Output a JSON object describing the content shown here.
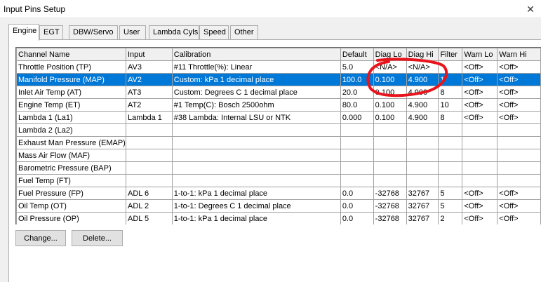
{
  "window": {
    "title": "Input Pins Setup",
    "close_glyph": "✕"
  },
  "tabs": [
    "Engine",
    "EGT",
    "DBW/Servo",
    "User",
    "Lambda Cyls",
    "Speed",
    "Other"
  ],
  "table": {
    "columns": [
      "Channel Name",
      "Input",
      "Calibration",
      "Default",
      "Diag Lo",
      "Diag Hi",
      "Filter",
      "Warn Lo",
      "Warn Hi"
    ],
    "rows": [
      [
        "Throttle Position  (TP)",
        "AV3",
        "#11 Throttle(%): Linear",
        "5.0",
        "<N/A>",
        "<N/A>",
        "",
        "<Off>",
        "<Off>"
      ],
      [
        "Manifold Pressure  (MAP)",
        "AV2",
        "Custom: kPa 1 decimal place",
        "100.0",
        "0.100",
        "4.900",
        "1",
        "<Off>",
        "<Off>"
      ],
      [
        "Inlet Air Temp  (AT)",
        "AT3",
        "Custom: Degrees C 1 decimal place",
        "20.0",
        "0.100",
        "4.900",
        "8",
        "<Off>",
        "<Off>"
      ],
      [
        "Engine Temp  (ET)",
        "AT2",
        "#1  Temp(C): Bosch 2500ohm",
        "80.0",
        "0.100",
        "4.900",
        "10",
        "<Off>",
        "<Off>"
      ],
      [
        "Lambda 1  (La1)",
        "Lambda 1",
        "#38 Lambda: Internal LSU or NTK",
        "0.000",
        "0.100",
        "4.900",
        "8",
        "<Off>",
        "<Off>"
      ],
      [
        "Lambda 2  (La2)",
        "",
        "",
        "",
        "",
        "",
        "",
        "",
        ""
      ],
      [
        "Exhaust Man Pressure  (EMAP)",
        "",
        "",
        "",
        "",
        "",
        "",
        "",
        ""
      ],
      [
        "Mass Air Flow  (MAF)",
        "",
        "",
        "",
        "",
        "",
        "",
        "",
        ""
      ],
      [
        "Barometric Pressure  (BAP)",
        "",
        "",
        "",
        "",
        "",
        "",
        "",
        ""
      ],
      [
        "Fuel Temp  (FT)",
        "",
        "",
        "",
        "",
        "",
        "",
        "",
        ""
      ],
      [
        "Fuel Pressure  (FP)",
        "ADL 6",
        "1-to-1: kPa 1 decimal place",
        "0.0",
        "-32768",
        "32767",
        "5",
        "<Off>",
        "<Off>"
      ],
      [
        "Oil Temp  (OT)",
        "ADL 2",
        "1-to-1: Degrees C 1 decimal place",
        "0.0",
        "-32768",
        "32767",
        "5",
        "<Off>",
        "<Off>"
      ],
      [
        "Oil Pressure  (OP)",
        "ADL 5",
        "1-to-1: kPa 1 decimal place",
        "0.0",
        "-32768",
        "32767",
        "2",
        "<Off>",
        "<Off>"
      ]
    ],
    "selected_row": 1
  },
  "buttons": {
    "change": "Change...",
    "delete": "Delete..."
  },
  "colors": {
    "selection": "#0078d7",
    "annotation": "#e8141c",
    "grid_line": "#a0a0a0",
    "window_bg": "#f0f0f0"
  },
  "icons": {
    "close": "close-icon"
  }
}
